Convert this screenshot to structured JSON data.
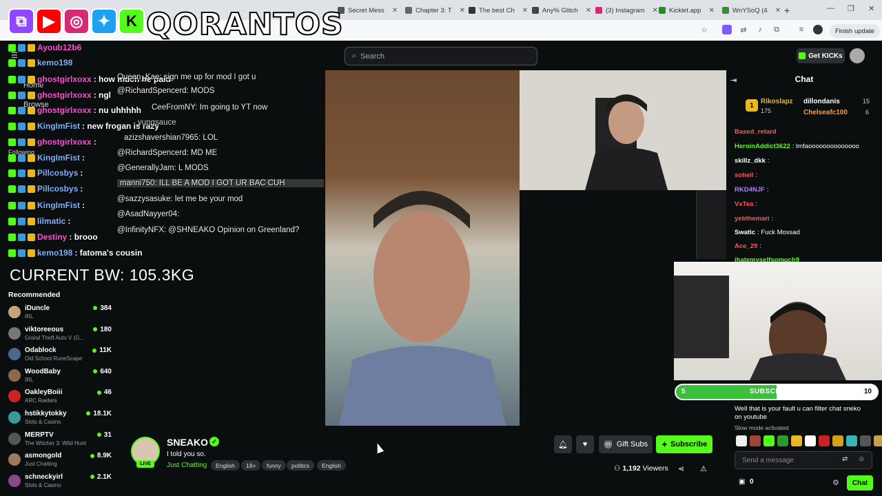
{
  "browser": {
    "tabs": [
      {
        "label": "Secret Mess",
        "color": "#555"
      },
      {
        "label": "Chapter 3: T",
        "color": "#666"
      },
      {
        "label": "The best Ch",
        "color": "#333"
      },
      {
        "label": "Any% Glitch",
        "color": "#444"
      },
      {
        "label": "(3) Instagram",
        "color": "#d62976"
      },
      {
        "label": "Kicklet.app",
        "color": "#2a8a2a"
      },
      {
        "label": "WnYSoQ (4",
        "color": "#3a8a3a"
      }
    ],
    "new_tab": "+",
    "finish_update": "Finish update"
  },
  "overlay": {
    "brand": "QORANTOS",
    "social_icons": [
      "twitch-icon",
      "youtube-icon",
      "instagram-icon",
      "twitter-icon",
      "kick-icon"
    ],
    "bodyweight": "CURRENT BW: 105.3KG",
    "chat": [
      {
        "user": "Ayoub12b6",
        "text": ""
      },
      {
        "user": "kemo198",
        "text": ""
      },
      {
        "user": "ghostgirlxoxx",
        "text": ": how much he paid"
      },
      {
        "user": "ghostgirlxoxx",
        "text": ": ngl"
      },
      {
        "user": "ghostgirlxoxx",
        "text": ": nu uhhhhh"
      },
      {
        "user": "KingImFist",
        "text": ": new frogan is razy"
      },
      {
        "user": "ghostgirlxoxx",
        "text": ":"
      },
      {
        "user": "KingImFist",
        "text": ":"
      },
      {
        "user": "Pillcosbys",
        "text": ":"
      },
      {
        "user": "Pillcosbys",
        "text": ":"
      },
      {
        "user": "KingImFist",
        "text": ":"
      },
      {
        "user": "lilmatic",
        "text": ":"
      },
      {
        "user": "Destiny",
        "text": ": brooo"
      },
      {
        "user": "kemo198",
        "text": ": fatoma's cousin"
      }
    ]
  },
  "header": {
    "search_placeholder": "Search",
    "get_kicks": "Get KICKs"
  },
  "sidebar": {
    "nav": [
      "Home",
      "Browse",
      "Following"
    ],
    "recommended_title": "Recommended",
    "recommended": [
      {
        "name": "iDuncle",
        "category": "IRL",
        "viewers": "384",
        "color": "#c9a27a"
      },
      {
        "name": "viktoreeous",
        "category": "Grand Theft Auto V (G...",
        "viewers": "180",
        "color": "#777"
      },
      {
        "name": "Odablock",
        "category": "Old School RuneScape",
        "viewers": "11K",
        "color": "#4a6a8a"
      },
      {
        "name": "WoodBaby",
        "category": "IRL",
        "viewers": "640",
        "color": "#8a6a4a"
      },
      {
        "name": "OakleyBoiii",
        "category": "ARC Raiders",
        "viewers": "46",
        "color": "#c22"
      },
      {
        "name": "hstikkytokky",
        "category": "Slots & Casino",
        "viewers": "18.1K",
        "color": "#3a9a9a"
      },
      {
        "name": "MERPTV",
        "category": "The Witcher 3: Wild Hunt",
        "viewers": "31",
        "color": "#555"
      },
      {
        "name": "asmongold",
        "category": "Just Chatting",
        "viewers": "8.9K",
        "color": "#9a7a5a"
      },
      {
        "name": "schneckyirl",
        "category": "Slots & Casino",
        "viewers": "2.1K",
        "color": "#8a4a8a"
      }
    ]
  },
  "video_chat": [
    {
      "text": "Queen_Kae: sign me up for mod I got u"
    },
    {
      "text": "@RichardSpencerd: MODS"
    },
    {
      "text": "CeeFromNY: Im going to YT now"
    },
    {
      "text": "yungsauce"
    },
    {
      "text": "azizshavershian7965: LOL"
    },
    {
      "text": "@RichardSpencerd: MD ME"
    },
    {
      "text": "@GenerallyJam: L MODS"
    },
    {
      "text": "manni750: ILL BE A MOD I GOT UR BAC CUH"
    },
    {
      "text": "@sazzysasuke: let me be your mod"
    },
    {
      "text": "@AsadNayyer04:"
    },
    {
      "text": "@InfinityNFX: @SHNEAKO Opinion on Greenland?"
    }
  ],
  "chat": {
    "title": "Chat",
    "pinned": [
      {
        "user": "Rikoslapz",
        "count": "175"
      },
      {
        "user": "dillondanis",
        "count": "15"
      },
      {
        "user": "Chelseafc100",
        "count": "6"
      }
    ],
    "messages": [
      {
        "user": "Based_retard",
        "text": "",
        "color": "#ff5555"
      },
      {
        "user": "HeroinAddict3622",
        "text": ": lmfaoooooooooooooo",
        "color": "#53fc18"
      },
      {
        "user": "skillz_dkk",
        "text": ":",
        "color": "#fff"
      },
      {
        "user": "soheil",
        "text": ":",
        "color": "#ff5555"
      },
      {
        "user": "RKD4NJF",
        "text": ":",
        "color": "#b67cff"
      },
      {
        "user": "VxTea",
        "text": ":",
        "color": "#ff5555"
      },
      {
        "user": "yebthemari",
        "text": ":",
        "color": "#ff5555"
      },
      {
        "user": "Swatic",
        "text": ": Fuck Mossad",
        "color": "#fff"
      },
      {
        "user": "Ace_29",
        "text": ":",
        "color": "#ff5555"
      },
      {
        "user": "ihatemyselfsomuch9",
        "text": "",
        "color": "#53fc18"
      }
    ],
    "after_cam": "Well that is your fault u can filter chat sneko on youtube",
    "slow_mode": "Slow mode activated",
    "input_placeholder": "Send a message",
    "points": "0",
    "send_label": "Chat"
  },
  "sub_goal": {
    "current": "5",
    "label": "SUBSCRIBERS",
    "target": "10",
    "progress": 0.5
  },
  "stream": {
    "streamer": "SNEAKO",
    "title": "I told you so.",
    "category": "Just Chatting",
    "tags": [
      "English",
      "18+",
      "funny",
      "politics",
      "English"
    ],
    "live": "LIVE",
    "gift_subs": "Gift Subs",
    "subscribe": "Subscribe",
    "viewers": "1,192",
    "viewers_label": "Viewers"
  }
}
